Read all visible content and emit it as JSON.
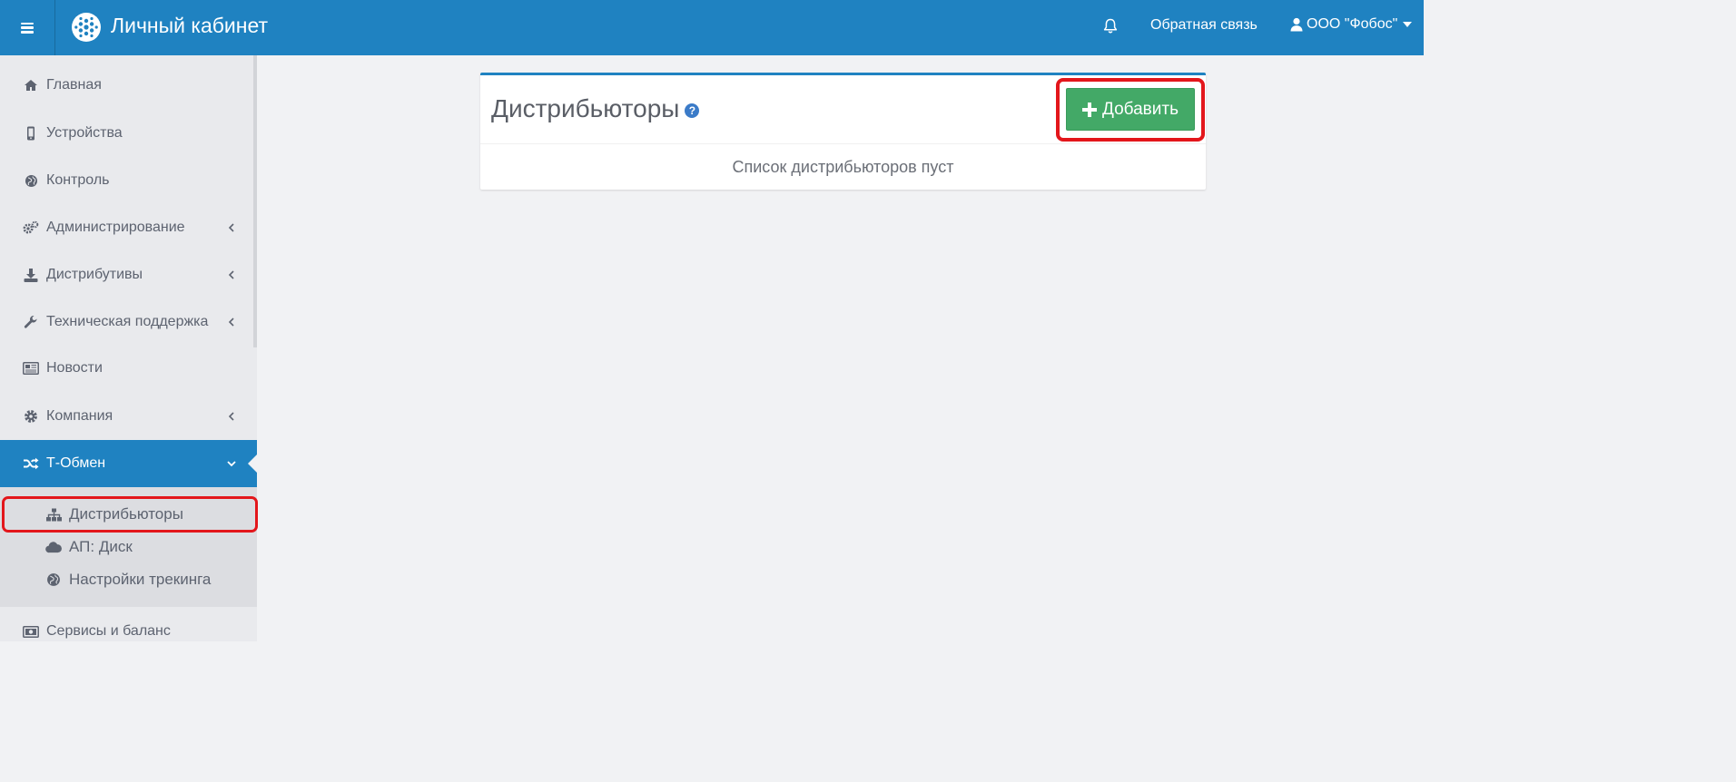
{
  "header": {
    "app_title": "Личный кабинет",
    "feedback_label": "Обратная связь",
    "user_label": "ООО \"Фобос\"",
    "icons": {
      "menu": "hamburger-icon",
      "logo": "logo-icon",
      "notifications": "bell-icon",
      "user": "user-icon",
      "user_menu": "caret-down-icon"
    }
  },
  "sidebar": {
    "items": [
      {
        "label": "Главная",
        "icon": "home-icon"
      },
      {
        "label": "Устройства",
        "icon": "mobile-icon"
      },
      {
        "label": "Контроль",
        "icon": "globe-icon"
      },
      {
        "label": "Администрирование",
        "icon": "gears-icon",
        "expandable": true
      },
      {
        "label": "Дистрибутивы",
        "icon": "download-icon",
        "expandable": true
      },
      {
        "label": "Техническая поддержка",
        "icon": "wrench-icon",
        "expandable": true
      },
      {
        "label": "Новости",
        "icon": "newspaper-icon"
      },
      {
        "label": "Компания",
        "icon": "gear-icon",
        "expandable": true
      },
      {
        "label": "Т-Обмен",
        "icon": "shuffle-icon",
        "expandable": true,
        "active": true
      },
      {
        "label": "Сервисы и баланс",
        "icon": "money-icon"
      }
    ],
    "submenu": [
      {
        "label": "Дистрибьюторы",
        "icon": "sitemap-icon",
        "selected": true
      },
      {
        "label": "АП: Диск",
        "icon": "cloud-icon"
      },
      {
        "label": "Настройки трекинга",
        "icon": "globe-icon"
      }
    ]
  },
  "main": {
    "panel_title": "Дистрибьюторы",
    "help_icon_glyph": "?",
    "add_button_label": "Добавить",
    "empty_message": "Список дистрибьюторов пуст"
  },
  "colors": {
    "topbar": "#1f82c1",
    "sidebar_bg": "#e9eaed",
    "submenu_bg": "#dcdde1",
    "active_item": "#1f82c1",
    "add_button": "#43a967",
    "highlight": "#e3161b",
    "page_bg": "#f1f2f4"
  }
}
